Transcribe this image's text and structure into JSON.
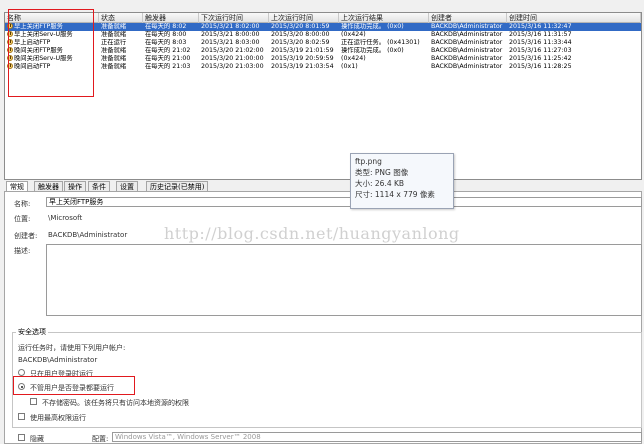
{
  "columns": [
    "名称",
    "状态",
    "触发器",
    "下次运行时间",
    "上次运行时间",
    "上次运行结果",
    "创建者",
    "创建时间"
  ],
  "tasks": [
    {
      "name": "早上关闭FTP服务",
      "status": "准备就绪",
      "trigger": "在每天的 8:02",
      "next_run": "2015/3/21 8:02:00",
      "last_run": "2015/3/20 8:01:59",
      "result": "操作成功完成。 (0x0)",
      "author": "BACKDB\\Administrator",
      "created": "2015/3/16 11:32:47",
      "selected": true
    },
    {
      "name": "早上关闭Serv-U服务",
      "status": "准备就绪",
      "trigger": "在每天的 8:00",
      "next_run": "2015/3/21 8:00:00",
      "last_run": "2015/3/20 8:00:00",
      "result": "(0x424)",
      "author": "BACKDB\\Administrator",
      "created": "2015/3/16 11:31:57",
      "selected": false
    },
    {
      "name": "早上启动FTP",
      "status": "正在运行",
      "trigger": "在每天的 8:03",
      "next_run": "2015/3/21 8:03:00",
      "last_run": "2015/3/20 8:02:59",
      "result": "正在运行任务。 (0x41301)",
      "author": "BACKDB\\Administrator",
      "created": "2015/3/16 11:33:44",
      "selected": false
    },
    {
      "name": "晚间关闭FTP服务",
      "status": "准备就绪",
      "trigger": "在每天的 21:02",
      "next_run": "2015/3/20 21:02:00",
      "last_run": "2015/3/19 21:01:59",
      "result": "操作成功完成。 (0x0)",
      "author": "BACKDB\\Administrator",
      "created": "2015/3/16 11:27:03",
      "selected": false
    },
    {
      "name": "晚间关闭Serv-U服务",
      "status": "准备就绪",
      "trigger": "在每天的 21:00",
      "next_run": "2015/3/20 21:00:00",
      "last_run": "2015/3/19 20:59:59",
      "result": "(0x424)",
      "author": "BACKDB\\Administrator",
      "created": "2015/3/16 11:25:42",
      "selected": false
    },
    {
      "name": "晚间启动FTP",
      "status": "准备就绪",
      "trigger": "在每天的 21:03",
      "next_run": "2015/3/20 21:03:00",
      "last_run": "2015/3/19 21:03:54",
      "result": "(0x1)",
      "author": "BACKDB\\Administrator",
      "created": "2015/3/16 11:28:25",
      "selected": false
    }
  ],
  "tabs": [
    "常规",
    "触发器",
    "操作",
    "条件",
    "设置",
    "历史记录(已禁用)"
  ],
  "general": {
    "name_label": "名称:",
    "name_value": "早上关闭FTP服务",
    "location_label": "位置:",
    "location_value": "\\Microsoft",
    "author_label": "创建者:",
    "author_value": "BACKDB\\Administrator",
    "desc_label": "描述:"
  },
  "security": {
    "title": "安全选项",
    "run_as_text": "运行任务时，请使用下列用户帐户:",
    "account": "BACKDB\\Administrator",
    "opt_logged_on": "只在用户登录时运行",
    "opt_whether": "不管用户是否登录都要运行",
    "opt_no_password": "不存储密码。该任务将只有访问本地资源的权限",
    "opt_highest": "使用最高权限运行"
  },
  "bottom": {
    "hidden_label": "隐藏",
    "config_label": "配置:",
    "config_value": "Windows Vista™, Windows Server™ 2008"
  },
  "tooltip": {
    "filename": "ftp.png",
    "type": "类型: PNG 图像",
    "size": "大小: 26.4 KB",
    "dimensions": "尺寸: 1114 x 779 像素"
  },
  "watermark": "http://blog.csdn.net/huangyanlong"
}
